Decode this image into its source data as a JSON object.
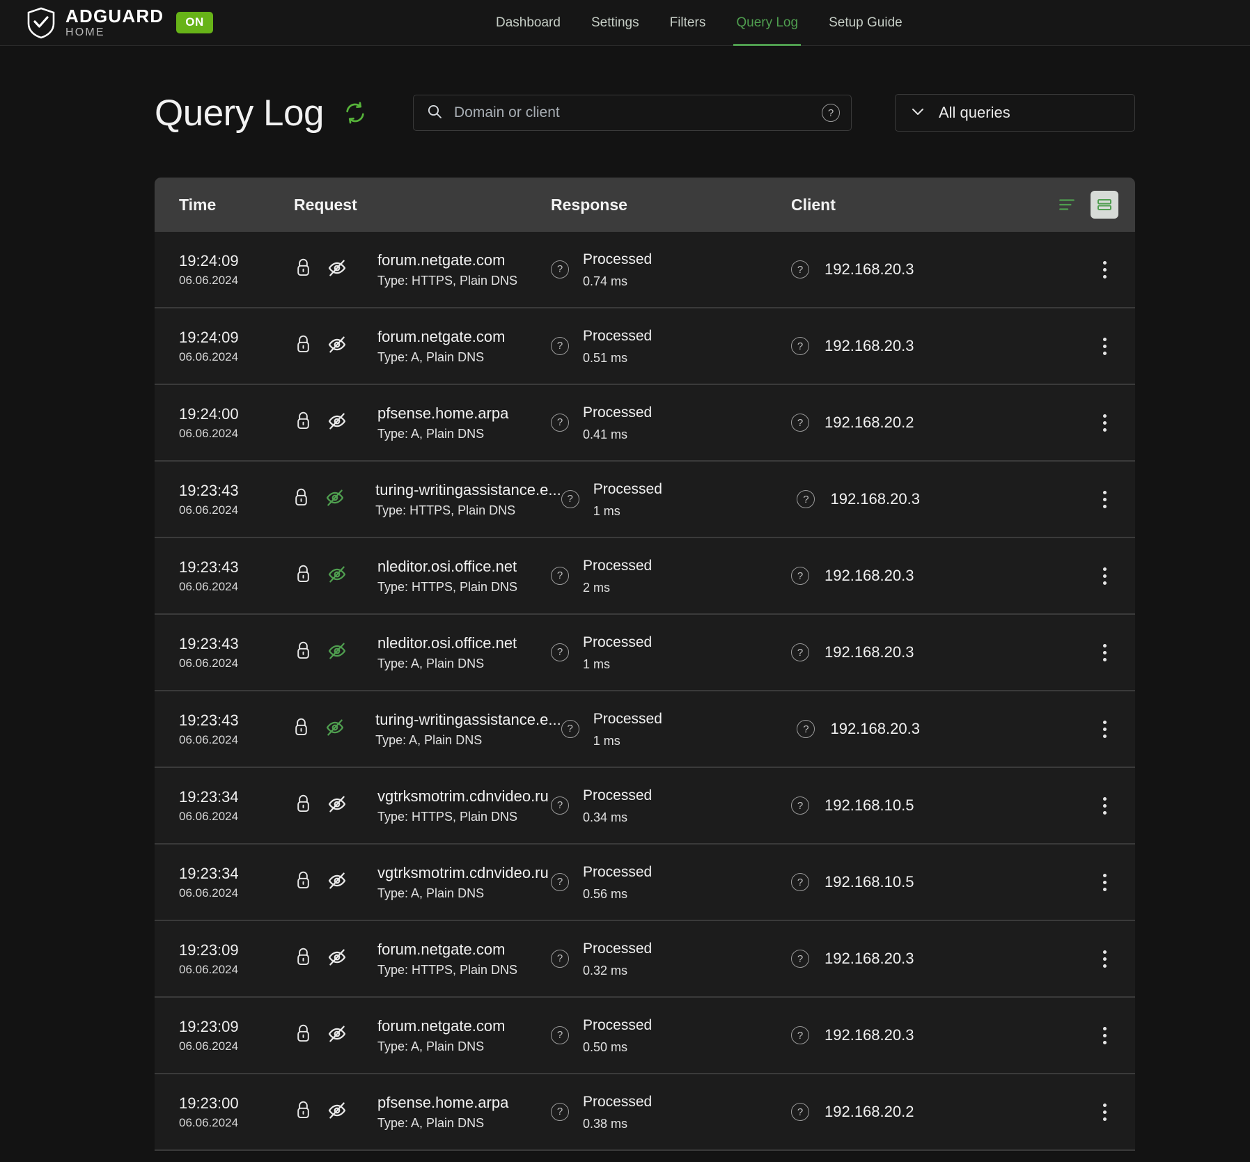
{
  "brand": {
    "title": "ADGUARD",
    "subtitle": "HOME",
    "status_badge": "ON",
    "badge_color": "#67b318",
    "shield_icon": "shield-check-icon"
  },
  "nav": {
    "items": [
      {
        "label": "Dashboard",
        "active": false
      },
      {
        "label": "Settings",
        "active": false
      },
      {
        "label": "Filters",
        "active": false
      },
      {
        "label": "Query Log",
        "active": true
      },
      {
        "label": "Setup Guide",
        "active": false
      }
    ],
    "accent_color": "#4f9e4f"
  },
  "page": {
    "title": "Query Log",
    "refresh_icon": "refresh-icon"
  },
  "search": {
    "placeholder": "Domain or client",
    "value": "",
    "icon": "search-icon",
    "help_icon": "question-circle-icon",
    "help_label": "?"
  },
  "filter": {
    "selected": "All queries",
    "chevron_icon": "chevron-down-icon"
  },
  "table": {
    "columns": [
      "Time",
      "Request",
      "Response",
      "Client"
    ],
    "view_toggles": [
      {
        "name": "compact-view-icon",
        "selected": false
      },
      {
        "name": "detailed-view-icon",
        "selected": true
      }
    ],
    "row_menu_icon": "kebab-menu-icon",
    "rows": [
      {
        "time": "19:24:09",
        "date": "06.06.2024",
        "lock_icon": "lock-icon",
        "eye_icon": "eye-off-icon",
        "eye_green": false,
        "domain": "forum.netgate.com",
        "type": "Type: HTTPS, Plain DNS",
        "response_help": "?",
        "status": "Processed",
        "elapsed": "0.74 ms",
        "client_help": "?",
        "client": "192.168.20.3"
      },
      {
        "time": "19:24:09",
        "date": "06.06.2024",
        "lock_icon": "lock-icon",
        "eye_icon": "eye-off-icon",
        "eye_green": false,
        "domain": "forum.netgate.com",
        "type": "Type: A, Plain DNS",
        "response_help": "?",
        "status": "Processed",
        "elapsed": "0.51 ms",
        "client_help": "?",
        "client": "192.168.20.3"
      },
      {
        "time": "19:24:00",
        "date": "06.06.2024",
        "lock_icon": "lock-icon",
        "eye_icon": "eye-off-icon",
        "eye_green": false,
        "domain": "pfsense.home.arpa",
        "type": "Type: A, Plain DNS",
        "response_help": "?",
        "status": "Processed",
        "elapsed": "0.41 ms",
        "client_help": "?",
        "client": "192.168.20.2"
      },
      {
        "time": "19:23:43",
        "date": "06.06.2024",
        "lock_icon": "lock-icon",
        "eye_icon": "eye-off-icon",
        "eye_green": true,
        "domain": "turing-writingassistance.e...",
        "type": "Type: HTTPS, Plain DNS",
        "response_help": "?",
        "status": "Processed",
        "elapsed": "1 ms",
        "client_help": "?",
        "client": "192.168.20.3"
      },
      {
        "time": "19:23:43",
        "date": "06.06.2024",
        "lock_icon": "lock-icon",
        "eye_icon": "eye-off-icon",
        "eye_green": true,
        "domain": "nleditor.osi.office.net",
        "type": "Type: HTTPS, Plain DNS",
        "response_help": "?",
        "status": "Processed",
        "elapsed": "2 ms",
        "client_help": "?",
        "client": "192.168.20.3"
      },
      {
        "time": "19:23:43",
        "date": "06.06.2024",
        "lock_icon": "lock-icon",
        "eye_icon": "eye-off-icon",
        "eye_green": true,
        "domain": "nleditor.osi.office.net",
        "type": "Type: A, Plain DNS",
        "response_help": "?",
        "status": "Processed",
        "elapsed": "1 ms",
        "client_help": "?",
        "client": "192.168.20.3"
      },
      {
        "time": "19:23:43",
        "date": "06.06.2024",
        "lock_icon": "lock-icon",
        "eye_icon": "eye-off-icon",
        "eye_green": true,
        "domain": "turing-writingassistance.e...",
        "type": "Type: A, Plain DNS",
        "response_help": "?",
        "status": "Processed",
        "elapsed": "1 ms",
        "client_help": "?",
        "client": "192.168.20.3"
      },
      {
        "time": "19:23:34",
        "date": "06.06.2024",
        "lock_icon": "lock-icon",
        "eye_icon": "eye-off-icon",
        "eye_green": false,
        "domain": "vgtrksmotrim.cdnvideo.ru",
        "type": "Type: HTTPS, Plain DNS",
        "response_help": "?",
        "status": "Processed",
        "elapsed": "0.34 ms",
        "client_help": "?",
        "client": "192.168.10.5"
      },
      {
        "time": "19:23:34",
        "date": "06.06.2024",
        "lock_icon": "lock-icon",
        "eye_icon": "eye-off-icon",
        "eye_green": false,
        "domain": "vgtrksmotrim.cdnvideo.ru",
        "type": "Type: A, Plain DNS",
        "response_help": "?",
        "status": "Processed",
        "elapsed": "0.56 ms",
        "client_help": "?",
        "client": "192.168.10.5"
      },
      {
        "time": "19:23:09",
        "date": "06.06.2024",
        "lock_icon": "lock-icon",
        "eye_icon": "eye-off-icon",
        "eye_green": false,
        "domain": "forum.netgate.com",
        "type": "Type: HTTPS, Plain DNS",
        "response_help": "?",
        "status": "Processed",
        "elapsed": "0.32 ms",
        "client_help": "?",
        "client": "192.168.20.3"
      },
      {
        "time": "19:23:09",
        "date": "06.06.2024",
        "lock_icon": "lock-icon",
        "eye_icon": "eye-off-icon",
        "eye_green": false,
        "domain": "forum.netgate.com",
        "type": "Type: A, Plain DNS",
        "response_help": "?",
        "status": "Processed",
        "elapsed": "0.50 ms",
        "client_help": "?",
        "client": "192.168.20.3"
      },
      {
        "time": "19:23:00",
        "date": "06.06.2024",
        "lock_icon": "lock-icon",
        "eye_icon": "eye-off-icon",
        "eye_green": false,
        "domain": "pfsense.home.arpa",
        "type": "Type: A, Plain DNS",
        "response_help": "?",
        "status": "Processed",
        "elapsed": "0.38 ms",
        "client_help": "?",
        "client": "192.168.20.2"
      }
    ]
  },
  "colors": {
    "page_bg": "#131313",
    "row_bg": "#1c1c1c",
    "header_bg": "#3c3c3c",
    "accent_green": "#4f9e4f",
    "badge_green": "#67b318"
  }
}
